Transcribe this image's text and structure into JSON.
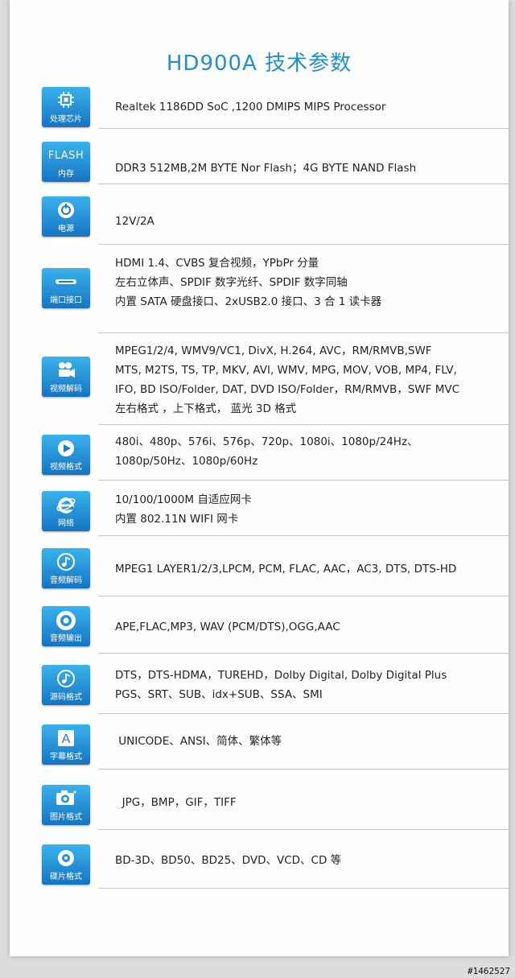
{
  "title": "HD900A  技术参数",
  "specs": [
    {
      "icon_name": "chip-icon",
      "label": "处理芯片",
      "lines": [
        "Realtek 1186DD   SoC ,1200 DMIPS MIPS Processor"
      ]
    },
    {
      "icon_name": "flash-icon",
      "label_top": "FLASH",
      "label": "内存",
      "lines": [
        "DDR3 512MB,2M BYTE Nor Flash；4G BYTE  NAND Flash"
      ]
    },
    {
      "icon_name": "power-icon",
      "label": "电源",
      "lines": [
        "12V/2A"
      ]
    },
    {
      "icon_name": "port-icon",
      "label": "端口接口",
      "lines": [
        "HDMI 1.4、CVBS 复合视频，YPbPr 分量",
        "左右立体声、SPDIF 数字光纤、SPDIF 数字同轴",
        "内置 SATA 硬盘接口、2xUSB2.0 接口、3 合 1 读卡器"
      ]
    },
    {
      "icon_name": "video-camera-icon",
      "label": "视频解码",
      "lines": [
        "MPEG1/2/4, WMV9/VC1, DivX, H.264, AVC，RM/RMVB,SWF",
        "MTS, M2TS, TS, TP, MKV, AVI, WMV, MPG, MOV, VOB, MP4, FLV,",
        " IFO, BD ISO/Folder, DAT, DVD ISO/Folder，RM/RMVB，SWF  MVC",
        "左右格式 ，上下格式， 蓝光 3D 格式"
      ]
    },
    {
      "icon_name": "play-icon",
      "label": "视频格式",
      "lines": [
        "480i、480p、576i、576p、720p、1080i、1080p/24Hz、",
        "1080p/50Hz、1080p/60Hz"
      ]
    },
    {
      "icon_name": "internet-explorer-icon",
      "label": "网络",
      "lines": [
        "10/100/1000M 自适应网卡",
        "内置 802.11N WIFI 网卡"
      ]
    },
    {
      "icon_name": "music-note-icon",
      "label": "音频解码",
      "lines": [
        "MPEG1 LAYER1/2/3,LPCM, PCM, FLAC, AAC，AC3, DTS, DTS-HD"
      ]
    },
    {
      "icon_name": "speaker-icon",
      "label": "音频输出",
      "lines": [
        "APE,FLAC,MP3, WAV (PCM/DTS),OGG,AAC"
      ]
    },
    {
      "icon_name": "music-note-icon",
      "label": "源码格式",
      "lines": [
        "DTS，DTS-HDMA，TUREHD，Dolby Digital, Dolby Digital Plus",
        "PGS、SRT、SUB、idx+SUB、SSA、SMI"
      ]
    },
    {
      "icon_name": "letter-a-icon",
      "label": "字幕格式",
      "lines": [
        " UNICODE、ANSI、简体、繁体等"
      ]
    },
    {
      "icon_name": "camera-icon",
      "label": "图片格式",
      "lines": [
        "  JPG，BMP，GIF，TIFF"
      ]
    },
    {
      "icon_name": "disc-icon",
      "label": "碟片格式",
      "lines": [
        "BD-3D、BD50、BD25、DVD、VCD、CD 等"
      ]
    }
  ],
  "watermark": "#1462527"
}
